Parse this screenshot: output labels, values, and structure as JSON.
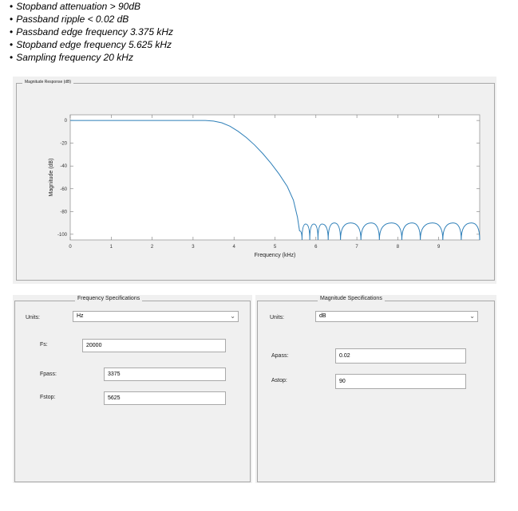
{
  "bullets": [
    "Stopband attenuation > 90dB",
    "Passband ripple < 0.02 dB",
    "Passband edge frequency 3.375 kHz",
    "Stopband edge frequency 5.625 kHz",
    "Sampling frequency 20 kHz"
  ],
  "plot_panel": {
    "title": "Magnitude Response (dB)"
  },
  "chart_data": {
    "type": "line",
    "xlabel": "Frequency (kHz)",
    "ylabel": "Magnitude (dB)",
    "xlim": [
      0,
      10
    ],
    "ylim": [
      -105,
      5
    ],
    "xticks": [
      0,
      1,
      2,
      3,
      4,
      5,
      6,
      7,
      8,
      9
    ],
    "yticks": [
      0,
      -20,
      -40,
      -60,
      -80,
      -100
    ],
    "grid": false,
    "line_color": "#2e7fb8",
    "series": [
      {
        "x": [
          0,
          0.5,
          1,
          1.5,
          2,
          2.5,
          3,
          3.3,
          3.5,
          3.7,
          3.9,
          4.1,
          4.3,
          4.5,
          4.7,
          4.9,
          5.1,
          5.3,
          5.45,
          5.55,
          5.6,
          5.66,
          5.75,
          5.85,
          5.95,
          6.05,
          6.15,
          6.3,
          6.45,
          6.6,
          6.85,
          7.1,
          7.35,
          7.55,
          7.85,
          8.1,
          8.35,
          8.55,
          8.85,
          9.1,
          9.35,
          9.55,
          9.8,
          10
        ],
        "y": [
          0,
          0,
          0,
          0,
          0,
          0,
          0,
          0,
          -0.5,
          -2,
          -5,
          -9.5,
          -15,
          -21.5,
          -29,
          -37.5,
          -47,
          -58,
          -70,
          -85,
          -97,
          -105,
          -91,
          -105,
          -91,
          -105,
          -91,
          -105,
          -90,
          -105,
          -90,
          -105,
          -90,
          -105,
          -90,
          -105,
          -90,
          -105,
          -90,
          -105,
          -90,
          -105,
          -90,
          -105
        ]
      }
    ]
  },
  "frequency_specs": {
    "title": "Frequency Specifications",
    "units_label": "Units:",
    "units_value": "Hz",
    "fs_label": "Fs:",
    "fs_value": "20000",
    "fpass_label": "Fpass:",
    "fpass_value": "3375",
    "fstop_label": "Fstop:",
    "fstop_value": "5625"
  },
  "magnitude_specs": {
    "title": "Magnitude Specifications",
    "units_label": "Units:",
    "units_value": "dB",
    "apass_label": "Apass:",
    "apass_value": "0.02",
    "astop_label": "Astop:",
    "astop_value": "90"
  }
}
